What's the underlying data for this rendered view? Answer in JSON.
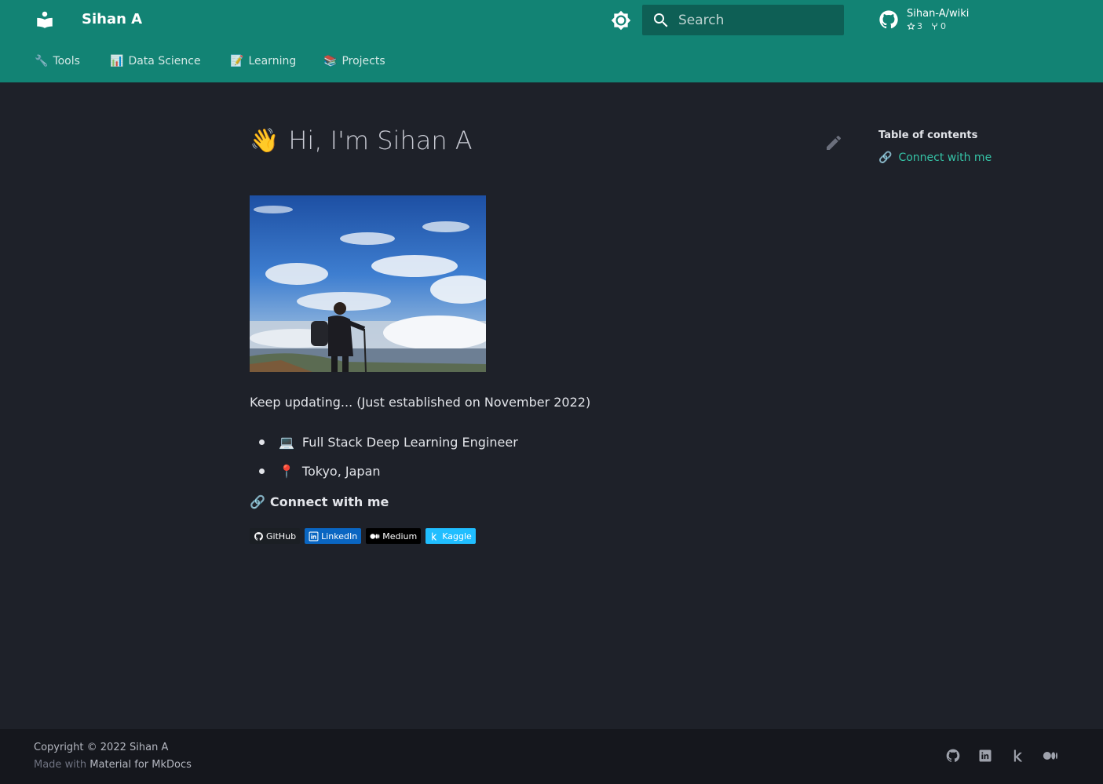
{
  "header": {
    "site_name": "Sihan A",
    "search_placeholder": "Search",
    "repo": {
      "name": "Sihan-A/wiki",
      "stars": "3",
      "forks": "0"
    }
  },
  "tabs": [
    {
      "emoji": "🔧",
      "label": "Tools"
    },
    {
      "emoji": "📊",
      "label": "Data Science"
    },
    {
      "emoji": "📝",
      "label": "Learning"
    },
    {
      "emoji": "📚",
      "label": "Projects"
    }
  ],
  "content": {
    "title_emoji": "👋",
    "title": "Hi, I'm Sihan A",
    "intro": "Keep updating... (Just established on November 2022)",
    "bullets": [
      {
        "emoji": "💻",
        "text": "Full Stack Deep Learning Engineer"
      },
      {
        "emoji": "📍",
        "text": "Tokyo, Japan"
      }
    ],
    "connect_emoji": "🔗",
    "connect_heading": "Connect with me",
    "badges": [
      {
        "label": "GitHub",
        "color": "#1b1f24",
        "icon": "github-icon"
      },
      {
        "label": "LinkedIn",
        "color": "#0a66c2",
        "icon": "linkedin-icon"
      },
      {
        "label": "Medium",
        "color": "#000000",
        "icon": "medium-icon"
      },
      {
        "label": "Kaggle",
        "color": "#20beff",
        "icon": "kaggle-icon"
      }
    ]
  },
  "toc": {
    "title": "Table of contents",
    "items": [
      {
        "emoji": "🔗",
        "label": "Connect with me"
      }
    ]
  },
  "footer": {
    "copyright": "Copyright © 2022 Sihan A",
    "made_with_prefix": "Made with",
    "made_with_link": "Material for MkDocs",
    "social_icons": [
      "github-icon",
      "linkedin-icon",
      "kaggle-icon",
      "medium-icon"
    ]
  },
  "colors": {
    "primary": "#128374",
    "background": "#1e2129",
    "accent_link": "#35c3a6",
    "footer": "#15171d"
  }
}
